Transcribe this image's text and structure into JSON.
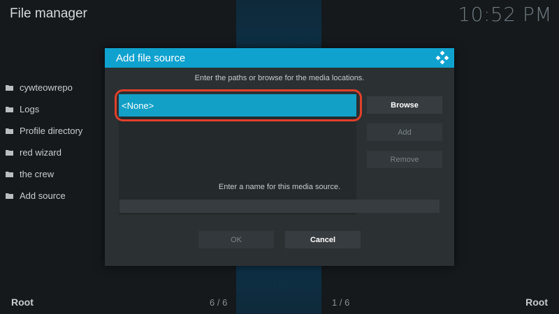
{
  "app": {
    "title": "File manager",
    "clock": "10:52 PM"
  },
  "sidebar": {
    "items": [
      {
        "label": "cywteowrepo",
        "icon": "folder-icon"
      },
      {
        "label": "Logs",
        "icon": "folder-icon"
      },
      {
        "label": "Profile directory",
        "icon": "folder-icon"
      },
      {
        "label": "red wizard",
        "icon": "folder-icon"
      },
      {
        "label": "the crew",
        "icon": "folder-icon"
      },
      {
        "label": "Add source",
        "icon": "folder-icon"
      }
    ]
  },
  "footer": {
    "left": "Root",
    "right": "Root",
    "count_left": "6 / 6",
    "count_right": "1 / 6"
  },
  "dialog": {
    "title": "Add file source",
    "logo_icon": "kodi-icon",
    "instruction": "Enter the paths or browse for the media locations.",
    "paths": [
      "<None>"
    ],
    "browse_label": "Browse",
    "add_label": "Add",
    "remove_label": "Remove",
    "name_label": "Enter a name for this media source.",
    "name_value": "",
    "ok_label": "OK",
    "cancel_label": "Cancel"
  },
  "colors": {
    "accent": "#10a2cf",
    "highlight": "#e0402a",
    "background": "#15191c",
    "dialog": "#2b3033"
  }
}
